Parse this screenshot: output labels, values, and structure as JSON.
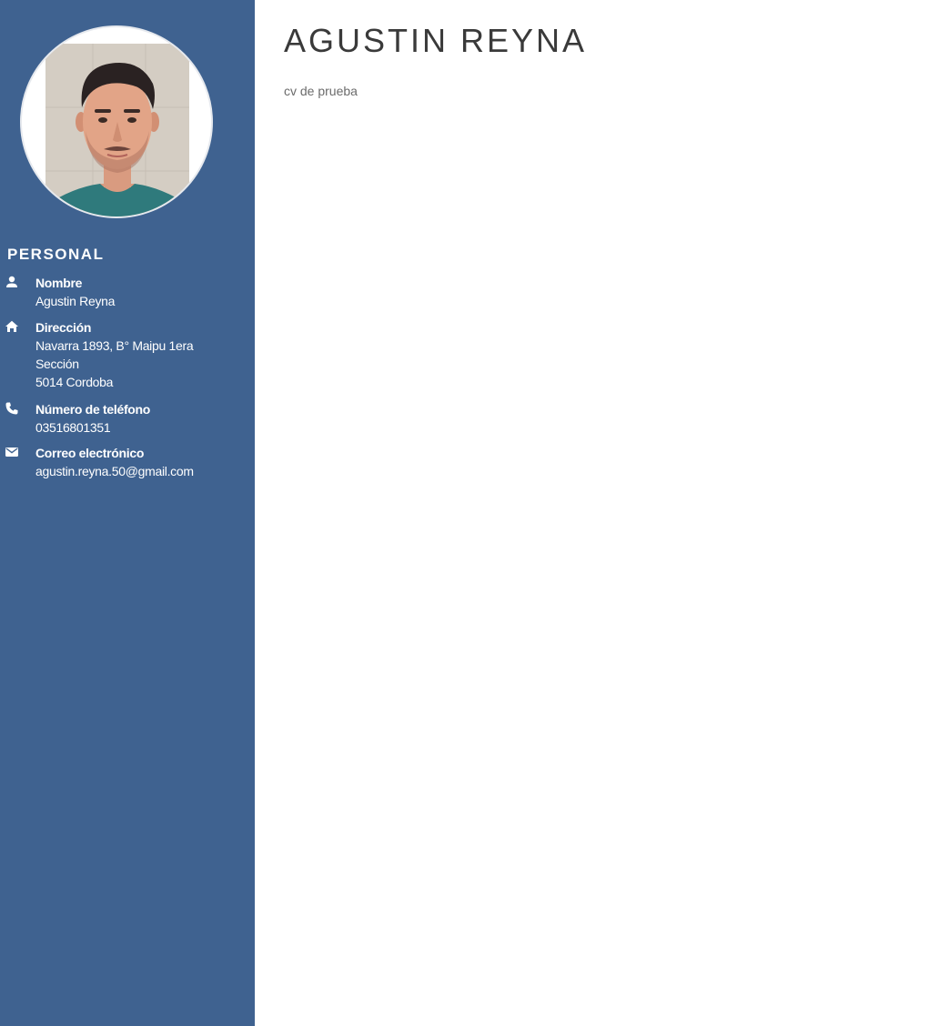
{
  "colors": {
    "sidebar_bg": "#3f6290",
    "sidebar_text": "#ffffff",
    "name_text": "#3a3a3a",
    "subtitle_text": "#6b6b6b"
  },
  "header": {
    "name": "AGUSTIN REYNA",
    "subtitle": "cv de prueba"
  },
  "sidebar": {
    "photo_icon": "profile-photo",
    "section_title": "PERSONAL",
    "items": [
      {
        "icon": "person-icon",
        "label": "Nombre",
        "value": "Agustin Reyna"
      },
      {
        "icon": "home-icon",
        "label": "Dirección",
        "value": "Navarra 1893, B° Maipu 1era\nSección\n5014 Cordoba"
      },
      {
        "icon": "phone-icon",
        "label": "Número de teléfono",
        "value": "03516801351"
      },
      {
        "icon": "mail-icon",
        "label": "Correo electrónico",
        "value": "agustin.reyna.50@gmail.com"
      }
    ]
  }
}
